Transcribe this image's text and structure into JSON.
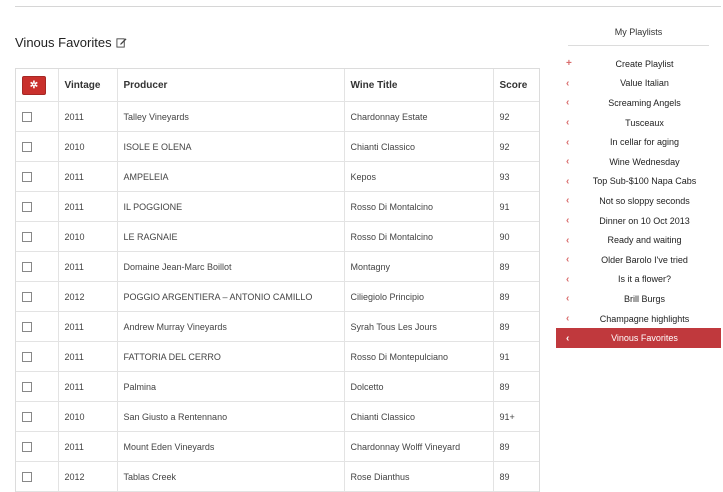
{
  "page": {
    "title": "Vinous Favorites"
  },
  "table": {
    "columns": [
      "Vintage",
      "Producer",
      "Wine Title",
      "Score"
    ],
    "rows": [
      {
        "vintage": "2011",
        "producer": "Talley Vineyards",
        "title": "Chardonnay Estate",
        "score": "92"
      },
      {
        "vintage": "2010",
        "producer": "ISOLE E OLENA",
        "title": "Chianti Classico",
        "score": "92"
      },
      {
        "vintage": "2011",
        "producer": "AMPELEIA",
        "title": "Kepos",
        "score": "93"
      },
      {
        "vintage": "2011",
        "producer": "IL POGGIONE",
        "title": "Rosso Di Montalcino",
        "score": "91"
      },
      {
        "vintage": "2010",
        "producer": "LE RAGNAIE",
        "title": "Rosso Di Montalcino",
        "score": "90"
      },
      {
        "vintage": "2011",
        "producer": "Domaine Jean-Marc Boillot",
        "title": "Montagny",
        "score": "89"
      },
      {
        "vintage": "2012",
        "producer": "POGGIO ARGENTIERA – ANTONIO CAMILLO",
        "title": "Ciliegiolo Principio",
        "score": "89"
      },
      {
        "vintage": "2011",
        "producer": "Andrew Murray Vineyards",
        "title": "Syrah Tous Les Jours",
        "score": "89"
      },
      {
        "vintage": "2011",
        "producer": "FATTORIA DEL CERRO",
        "title": "Rosso Di Montepulciano",
        "score": "91"
      },
      {
        "vintage": "2011",
        "producer": "Palmina",
        "title": "Dolcetto",
        "score": "89"
      },
      {
        "vintage": "2010",
        "producer": "San Giusto a Rentennano",
        "title": "Chianti Classico",
        "score": "91+"
      },
      {
        "vintage": "2011",
        "producer": "Mount Eden Vineyards",
        "title": "Chardonnay Wolff Vineyard",
        "score": "89"
      },
      {
        "vintage": "2012",
        "producer": "Tablas Creek",
        "title": "Rose Dianthus",
        "score": "89"
      }
    ]
  },
  "sidebar": {
    "title": "My Playlists",
    "create_label": "Create Playlist",
    "playlists": [
      "Value Italian",
      "Screaming Angels",
      "Tusceaux",
      "In cellar for aging",
      "Wine Wednesday",
      "Top Sub-$100 Napa Cabs",
      "Not so sloppy seconds",
      "Dinner on 10 Oct 2013",
      "Ready and waiting",
      "Older Barolo I've tried",
      "Is it a flower?",
      "Brill Burgs",
      "Champagne highlights",
      "Vinous Favorites"
    ],
    "active": "Vinous Favorites"
  },
  "colors": {
    "accent": "#c0393d",
    "icon": "#d96c6c"
  }
}
